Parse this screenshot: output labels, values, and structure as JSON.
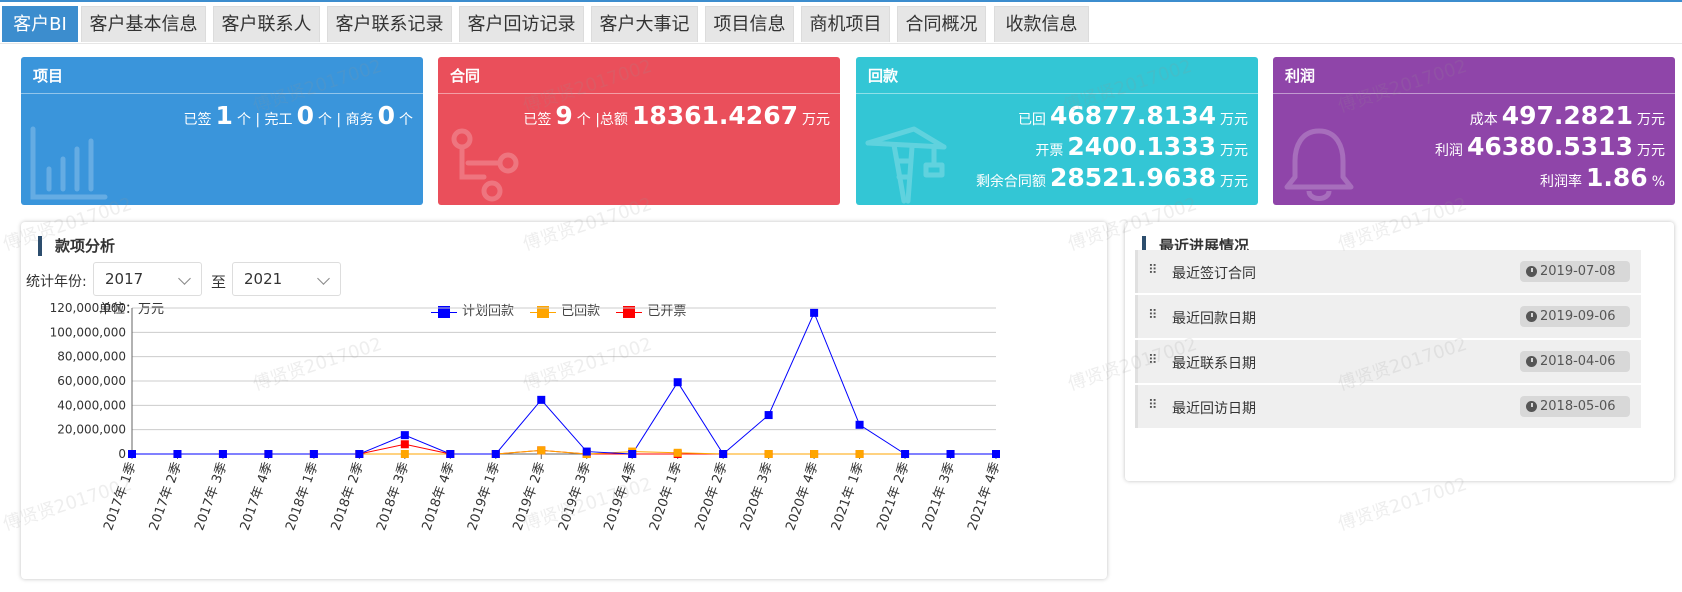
{
  "tabs": [
    "客户BI",
    "客户基本信息",
    "客户联系人",
    "客户联系记录",
    "客户回访记录",
    "客户大事记",
    "项目信息",
    "商机项目",
    "合同概况",
    "收款信息"
  ],
  "cards": {
    "project": {
      "title": "项目",
      "signed_label": "已签",
      "signed_value": "1",
      "unit1": "个 | 完工",
      "done_value": "0",
      "unit2": "个 | 商务",
      "biz_value": "0",
      "unit3": "个"
    },
    "contract": {
      "title": "合同",
      "signed_label": "已签",
      "signed_value": "9",
      "unit1": "个 |总额",
      "total_value": "18361.4267",
      "unit2": "万元"
    },
    "payment": {
      "title": "回款",
      "received_label": "已回",
      "received_value": "46877.8134",
      "invoiced_label": "开票",
      "invoiced_value": "2400.1333",
      "remain_label": "剩余合同额",
      "remain_value": "28521.9638",
      "unit": "万元"
    },
    "profit": {
      "title": "利润",
      "cost_label": "成本",
      "cost_value": "497.2821",
      "profit_label": "利润",
      "profit_value": "46380.5313",
      "rate_label": "利润率",
      "rate_value": "1.86",
      "unit": "万元",
      "rate_unit": "%"
    }
  },
  "chart_panel": {
    "title": "款项分析",
    "filter_label": "统计年份:",
    "year_from": "2017",
    "to_label": "至",
    "year_to": "2021",
    "unit_label": "单位：万元"
  },
  "recent": {
    "title": "最近进展情况",
    "items": [
      {
        "label": "最近签订合同",
        "date": "2019-07-08"
      },
      {
        "label": "最近回款日期",
        "date": "2019-09-06"
      },
      {
        "label": "最近联系日期",
        "date": "2018-04-06"
      },
      {
        "label": "最近回访日期",
        "date": "2018-05-06"
      }
    ]
  },
  "watermark": "傅贤贤2017002",
  "colors": {
    "planned": "#0000ff",
    "received": "#ffa500",
    "invoiced": "#ff0000",
    "project": "#3a95db",
    "contract": "#ea4f5b",
    "payment": "#33c6d5",
    "profit": "#8f45a9"
  },
  "chart_data": {
    "type": "line",
    "categories": [
      "2017年 1季",
      "2017年 2季",
      "2017年 3季",
      "2017年 4季",
      "2018年 1季",
      "2018年 2季",
      "2018年 3季",
      "2018年 4季",
      "2019年 1季",
      "2019年 2季",
      "2019年 3季",
      "2019年 4季",
      "2020年 1季",
      "2020年 2季",
      "2020年 3季",
      "2020年 4季",
      "2021年 1季",
      "2021年 2季",
      "2021年 3季",
      "2021年 4季"
    ],
    "series": [
      {
        "name": "计划回款",
        "color": "#0000ff",
        "values": [
          0,
          0,
          0,
          0,
          0,
          0,
          15500000,
          0,
          0,
          44500000,
          2000000,
          0,
          59000000,
          0,
          32000000,
          116000000,
          24000000,
          0,
          0,
          0
        ]
      },
      {
        "name": "已回款",
        "color": "#ffa500",
        "values": [
          0,
          0,
          0,
          0,
          0,
          0,
          0,
          0,
          0,
          3000000,
          0,
          2000000,
          1000000,
          0,
          0,
          0,
          0,
          0,
          0,
          0
        ]
      },
      {
        "name": "已开票",
        "color": "#ff0000",
        "values": [
          0,
          0,
          0,
          0,
          0,
          0,
          8000000,
          0,
          0,
          3000000,
          0,
          0,
          0,
          0,
          0,
          0,
          0,
          0,
          0,
          0
        ]
      }
    ],
    "ylim": [
      0,
      120000000
    ],
    "yticks": [
      "0",
      "20,000,000",
      "40,000,000",
      "60,000,000",
      "80,000,000",
      "100,000,000",
      "120,000,000"
    ],
    "grid": true,
    "legend": "top-center"
  }
}
